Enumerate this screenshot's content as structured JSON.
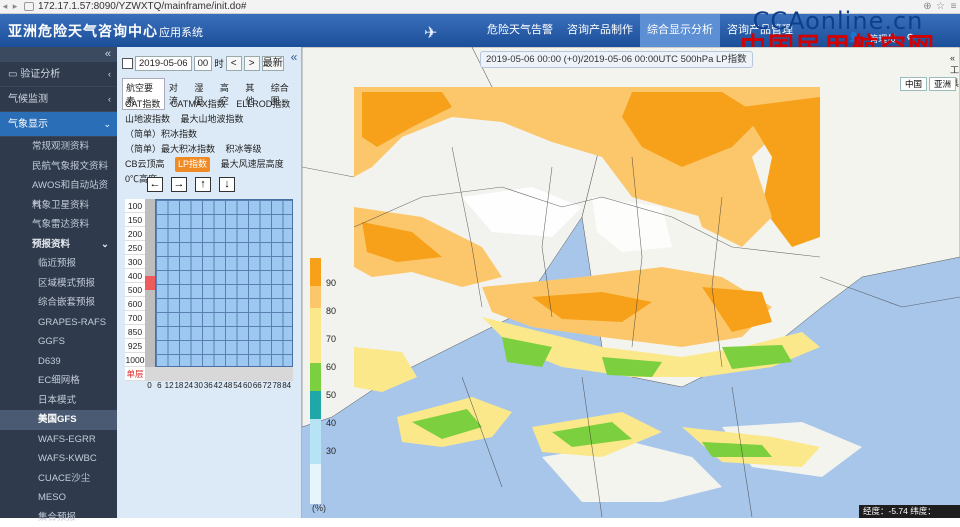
{
  "browser": {
    "url": "172.17.1.57:8090/YZWXTQ/mainframe/init.do#"
  },
  "header": {
    "title_main": "亚洲危险天气咨询中心",
    "title_sub": "应用系统",
    "nav": [
      "危险天气告警",
      "咨询产品制作",
      "综合显示分析",
      "咨询产品管理"
    ],
    "nav_active_index": 2,
    "user": "管理员"
  },
  "watermark": {
    "line1": "CCAonline.cn",
    "line2": "中国民用航空网"
  },
  "sidebar": {
    "collapse": "«",
    "items": [
      {
        "label": "验证分析",
        "arrow": "‹"
      },
      {
        "label": "气候监测",
        "arrow": "‹"
      },
      {
        "label": "气象显示",
        "arrow": "⌄"
      }
    ],
    "sub": [
      "常规观测资料",
      "民航气象报文资料",
      "AWOS和自动站资料",
      "气象卫星资料",
      "气象雷达资料"
    ],
    "forecast_label": "预报资料",
    "forecast_items": [
      "临近预报",
      "区域模式预报",
      "综合嵌套预报",
      "GRAPES-RAFS",
      "GGFS",
      "D639",
      "EC细网格",
      "日本模式",
      "美国GFS",
      "WAFS-EGRR",
      "WAFS-KWBC",
      "CUACE沙尘",
      "MESO",
      "集合预报"
    ],
    "forecast_active_index": 8
  },
  "panel": {
    "date": "2019-05-06",
    "hour": "00",
    "hour_unit": "时",
    "prev": "<",
    "next": ">",
    "latest": "最新",
    "collapse": "«",
    "tabs": [
      "航空要素",
      "对流",
      "湿阻",
      "高空",
      "其他",
      "综合图"
    ],
    "tab_active_index": 0,
    "params": [
      "CAT指数",
      "CATMAX指数",
      "ELLROD指数",
      "山地波指数",
      "最大山地波指数",
      "（简单）积冰指数",
      "（简单）最大积冰指数",
      "积冰等级",
      "CB云顶高",
      "LP指数",
      "最大风速层高度",
      "0℃高度"
    ],
    "param_active_index": 9,
    "arrows": [
      "←",
      "→",
      "↑",
      "↓"
    ],
    "levels": [
      "100",
      "150",
      "200",
      "250",
      "300",
      "400",
      "500",
      "600",
      "700",
      "850",
      "925",
      "1000",
      "单层"
    ],
    "level_selected": "500",
    "hours": [
      "0",
      "6",
      "12",
      "18",
      "24",
      "30",
      "36",
      "42",
      "48",
      "54",
      "60",
      "66",
      "72",
      "78",
      "84"
    ]
  },
  "map": {
    "time_range": "2019-05-06 00:00 (+0)/2019-05-06 00:00UTC 500hPa LP指数",
    "tools": "«  工具",
    "region_tabs": [
      "中国",
      "亚洲"
    ],
    "legend_ticks": [
      "90",
      "80",
      "70",
      "60",
      "50",
      "40",
      "30"
    ],
    "legend_unit": "(%)",
    "coords": "经度：-5.74 纬度：58.71",
    "colors": {
      "orange": "#f7a11a",
      "light_orange": "#fcc76a",
      "yellow": "#fbe88a",
      "green": "#7ccf3e",
      "teal": "#20a8a8",
      "sky": "#b6e4f5"
    }
  }
}
